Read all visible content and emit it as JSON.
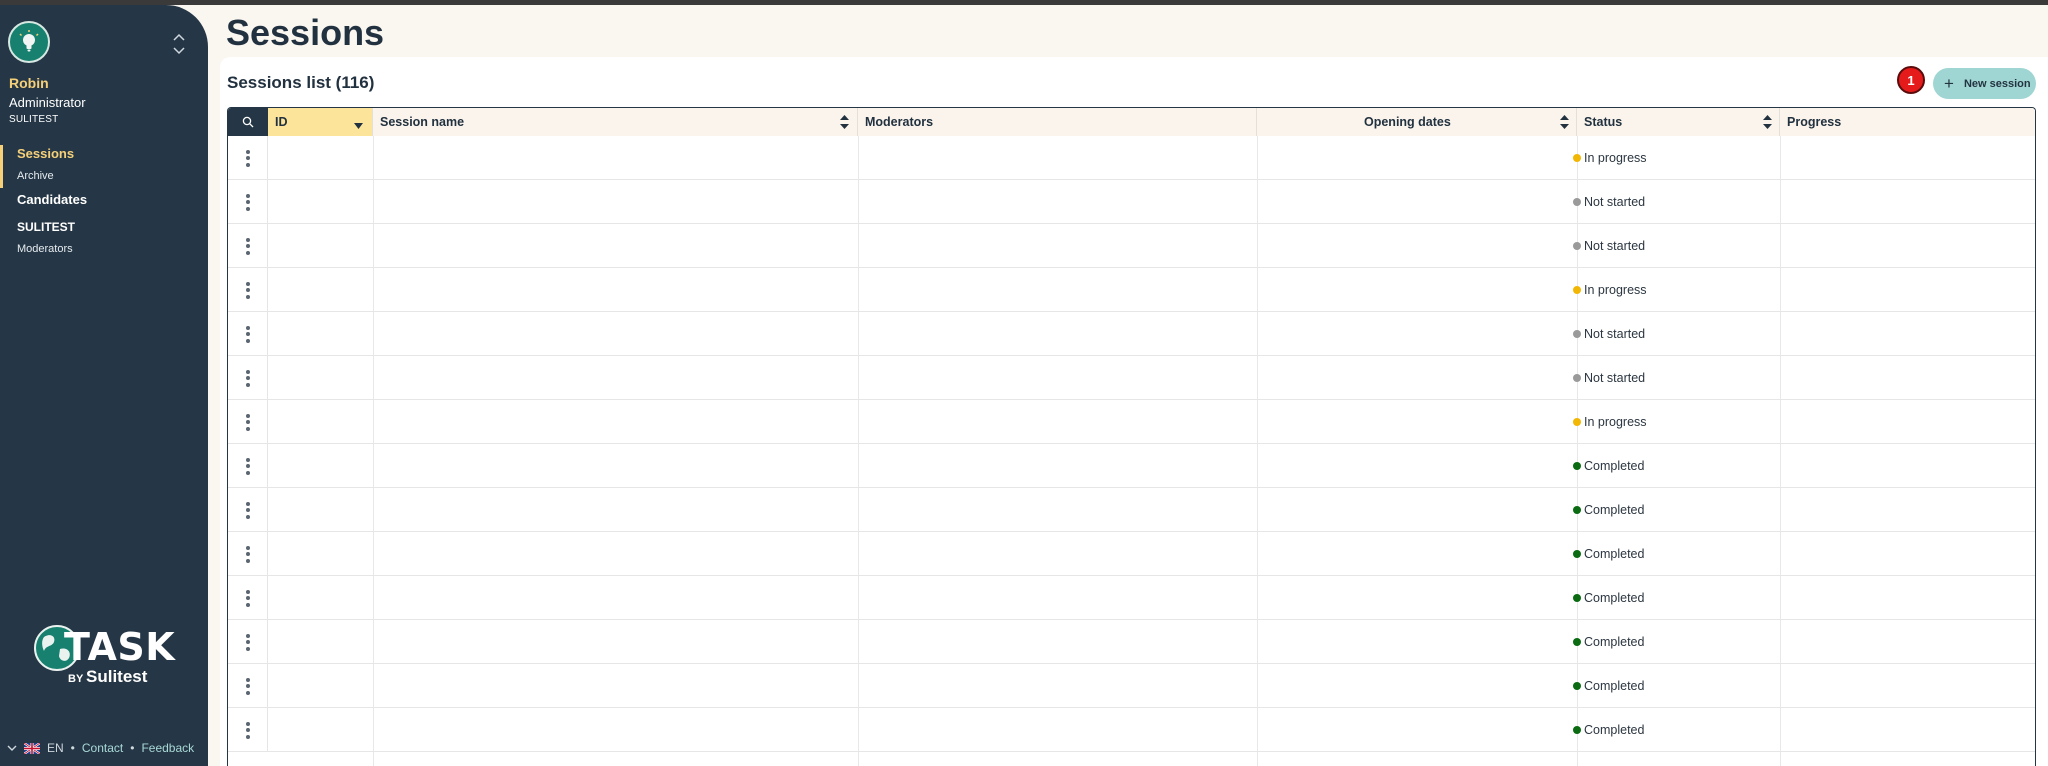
{
  "sidebar": {
    "user": {
      "name": "Robin",
      "role": "Administrator",
      "org": "SULITEST"
    },
    "nav": {
      "sessions": "Sessions",
      "archive": "Archive",
      "candidates": "Candidates",
      "org_heading": "SULITEST",
      "moderators": "Moderators"
    },
    "brand": {
      "word": "TASK",
      "by": "BY",
      "name": "Sulitest"
    },
    "footer": {
      "language": "EN",
      "contact": "Contact",
      "feedback": "Feedback",
      "separator": "•"
    }
  },
  "page": {
    "title": "Sessions"
  },
  "card": {
    "title": "Sessions list (116)",
    "notification_count": "1",
    "new_session_label": "New session"
  },
  "table": {
    "columns": {
      "id": "ID",
      "session_name": "Session name",
      "moderators": "Moderators",
      "opening_dates": "Opening dates",
      "status": "Status",
      "progress": "Progress"
    },
    "rows": [
      {
        "status": "In progress",
        "status_color": "#f2b705"
      },
      {
        "status": "Not started",
        "status_color": "#9a9a9a"
      },
      {
        "status": "Not started",
        "status_color": "#9a9a9a"
      },
      {
        "status": "In progress",
        "status_color": "#f2b705"
      },
      {
        "status": "Not started",
        "status_color": "#9a9a9a"
      },
      {
        "status": "Not started",
        "status_color": "#9a9a9a"
      },
      {
        "status": "In progress",
        "status_color": "#f2b705"
      },
      {
        "status": "Completed",
        "status_color": "#0a6b12"
      },
      {
        "status": "Completed",
        "status_color": "#0a6b12"
      },
      {
        "status": "Completed",
        "status_color": "#0a6b12"
      },
      {
        "status": "Completed",
        "status_color": "#0a6b12"
      },
      {
        "status": "Completed",
        "status_color": "#0a6b12"
      },
      {
        "status": "Completed",
        "status_color": "#0a6b12"
      },
      {
        "status": "Completed",
        "status_color": "#0a6b12"
      }
    ]
  },
  "colors": {
    "sidebar_bg": "#253746",
    "accent_yellow": "#f5d079",
    "teal": "#17806f",
    "new_button": "#9fd6d3",
    "badge_red": "#e51b1b"
  }
}
